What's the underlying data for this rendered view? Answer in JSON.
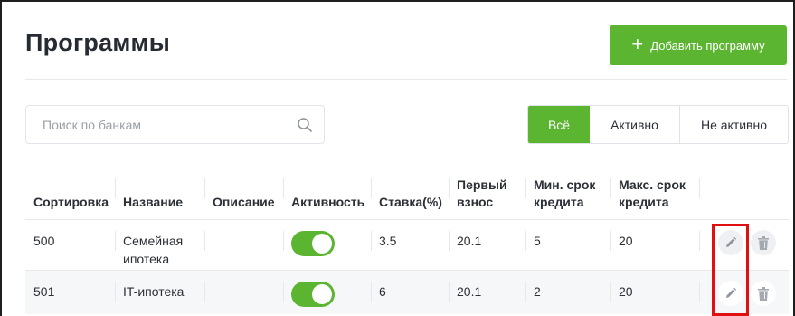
{
  "page": {
    "title": "Программы"
  },
  "header": {
    "add_button_label": "Добавить программу"
  },
  "search": {
    "placeholder": "Поиск по банкам"
  },
  "filters": {
    "all": "Всё",
    "active": "Активно",
    "inactive": "Не активно",
    "selected": "Всё"
  },
  "table": {
    "columns": {
      "sort": "Сортировка",
      "name": "Название",
      "description": "Описание",
      "activity": "Активность",
      "rate": "Ставка(%)",
      "first_payment_l1": "Первый",
      "first_payment_l2": "взнос",
      "min_term_l1": "Мин. срок",
      "min_term_l2": "кредита",
      "max_term_l1": "Макс. срок",
      "max_term_l2": "кредита"
    },
    "rows": [
      {
        "sort": "500",
        "name_l1": "Семейная",
        "name_l2": "ипотека",
        "description": "",
        "active": true,
        "rate": "3.5",
        "first_payment": "20.1",
        "min_term": "5",
        "max_term": "20"
      },
      {
        "sort": "501",
        "name_l1": "IT-ипотека",
        "name_l2": "",
        "description": "",
        "active": true,
        "rate": "6",
        "first_payment": "20.1",
        "min_term": "2",
        "max_term": "20"
      }
    ]
  },
  "colors": {
    "accent": "#5cb531",
    "highlight": "#e01010"
  },
  "icons": {
    "search": "search-icon",
    "add": "plus-icon",
    "edit": "pencil-icon",
    "delete": "trash-icon"
  }
}
